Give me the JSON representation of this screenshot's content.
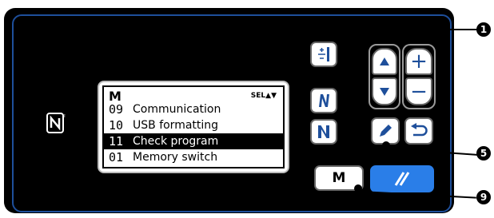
{
  "lcd": {
    "title": "M",
    "sel_label": "SEL▲▼",
    "rows": [
      {
        "num": "09",
        "label": "Communication",
        "selected": false
      },
      {
        "num": "10",
        "label": "USB formatting",
        "selected": false
      },
      {
        "num": "11",
        "label": "Check program",
        "selected": true
      },
      {
        "num": "01",
        "label": "Memory switch",
        "selected": false
      }
    ]
  },
  "buttons": {
    "m_label": "M",
    "plus": "+",
    "minus": "−"
  },
  "callouts": {
    "c1": "1",
    "c5": "5",
    "c9": "9"
  },
  "colors": {
    "panel": "#000000",
    "border_blue": "#1e4f9b",
    "reset_blue": "#2a7ee8"
  },
  "icons": [
    "nfc-icon",
    "threading-icon",
    "reverse-feed-icon",
    "normal-feed-icon",
    "edit-pencil-icon",
    "return-icon",
    "reset-icon"
  ]
}
